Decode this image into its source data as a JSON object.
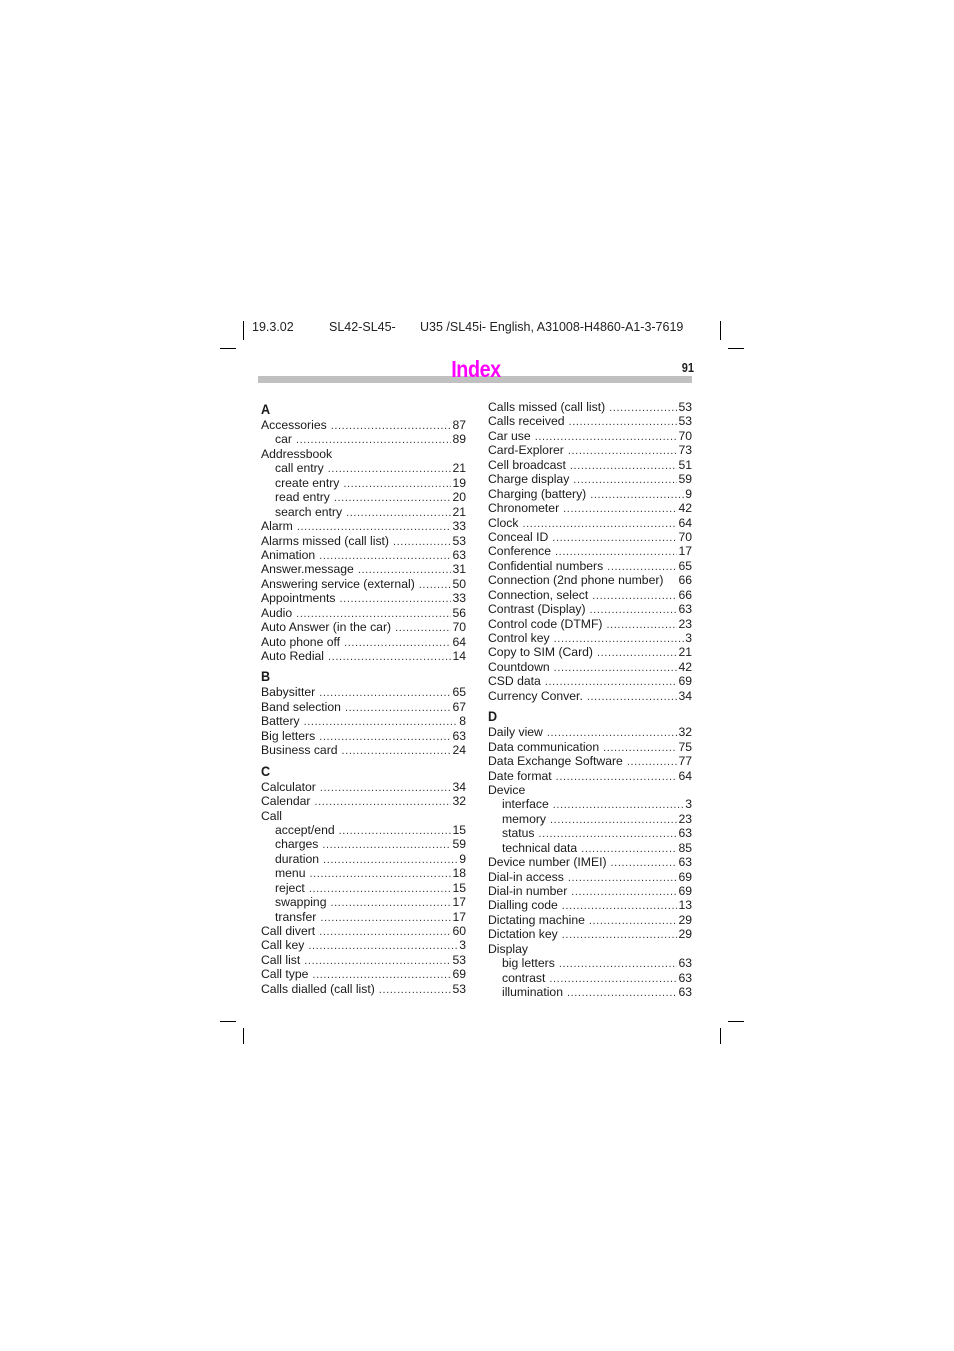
{
  "header": {
    "date": "19.3.02",
    "model": "SL42-SL45-",
    "doc_id": "U35 /SL45i- English, A31008-H4860-A1-3-7619"
  },
  "title": "Index",
  "page_number": "91",
  "colors": {
    "title": "#ff00ff",
    "rule": "#c0c0c0"
  },
  "columns": [
    {
      "sections": [
        {
          "letter": "A",
          "entries": [
            {
              "term": "Accessories",
              "page": "87"
            },
            {
              "term": "car",
              "page": "89",
              "sub": true
            },
            {
              "term": "Addressbook",
              "page": ""
            },
            {
              "term": "call entry",
              "page": "21",
              "sub": true
            },
            {
              "term": "create entry",
              "page": "19",
              "sub": true
            },
            {
              "term": "read entry",
              "page": "20",
              "sub": true
            },
            {
              "term": "search entry",
              "page": "21",
              "sub": true
            },
            {
              "term": "Alarm",
              "page": "33"
            },
            {
              "term": "Alarms missed (call list)",
              "page": "53"
            },
            {
              "term": "Animation",
              "page": "63"
            },
            {
              "term": "Answer.message",
              "page": "31"
            },
            {
              "term": "Answering service (external)",
              "page": "50"
            },
            {
              "term": "Appointments",
              "page": "33"
            },
            {
              "term": "Audio",
              "page": "56"
            },
            {
              "term": "Auto Answer (in the car)",
              "page": "70"
            },
            {
              "term": "Auto phone off",
              "page": "64"
            },
            {
              "term": "Auto Redial",
              "page": "14"
            }
          ]
        },
        {
          "letter": "B",
          "entries": [
            {
              "term": "Babysitter",
              "page": "65"
            },
            {
              "term": "Band selection",
              "page": "67"
            },
            {
              "term": "Battery",
              "page": "8"
            },
            {
              "term": "Big letters",
              "page": "63"
            },
            {
              "term": "Business card",
              "page": "24"
            }
          ]
        },
        {
          "letter": "C",
          "entries": [
            {
              "term": "Calculator",
              "page": "34"
            },
            {
              "term": "Calendar",
              "page": "32"
            },
            {
              "term": "Call",
              "page": ""
            },
            {
              "term": "accept/end",
              "page": "15",
              "sub": true
            },
            {
              "term": "charges",
              "page": "59",
              "sub": true
            },
            {
              "term": "duration",
              "page": "9",
              "sub": true
            },
            {
              "term": "menu",
              "page": "18",
              "sub": true
            },
            {
              "term": "reject",
              "page": "15",
              "sub": true
            },
            {
              "term": "swapping",
              "page": "17",
              "sub": true
            },
            {
              "term": "transfer",
              "page": "17",
              "sub": true
            },
            {
              "term": "Call divert",
              "page": "60"
            },
            {
              "term": "Call key",
              "page": "3"
            },
            {
              "term": "Call list",
              "page": "53"
            },
            {
              "term": "Call type",
              "page": "69"
            },
            {
              "term": "Calls dialled (call list)",
              "page": "53"
            }
          ]
        }
      ]
    },
    {
      "sections": [
        {
          "letter": "",
          "entries": [
            {
              "term": "Calls missed (call list)",
              "page": "53"
            },
            {
              "term": "Calls received",
              "page": "53"
            },
            {
              "term": "Car use",
              "page": "70"
            },
            {
              "term": "Card-Explorer",
              "page": "73"
            },
            {
              "term": "Cell broadcast",
              "page": "51"
            },
            {
              "term": "Charge display",
              "page": "59"
            },
            {
              "term": "Charging (battery)",
              "page": "9"
            },
            {
              "term": "Chronometer",
              "page": "42"
            },
            {
              "term": "Clock",
              "page": "64"
            },
            {
              "term": "Conceal ID",
              "page": "70"
            },
            {
              "term": "Conference",
              "page": "17"
            },
            {
              "term": "Confidential numbers",
              "page": "65"
            },
            {
              "term": "Connection (2nd phone number)",
              "page": "66",
              "nodots": true
            },
            {
              "term": "Connection, select",
              "page": "66"
            },
            {
              "term": "Contrast (Display)",
              "page": "63"
            },
            {
              "term": "Control code (DTMF)",
              "page": "23"
            },
            {
              "term": "Control key",
              "page": "3"
            },
            {
              "term": "Copy to SIM (Card)",
              "page": "21"
            },
            {
              "term": "Countdown",
              "page": "42"
            },
            {
              "term": "CSD data",
              "page": "69"
            },
            {
              "term": "Currency Conver.",
              "page": "34"
            }
          ]
        },
        {
          "letter": "D",
          "entries": [
            {
              "term": "Daily view",
              "page": "32"
            },
            {
              "term": "Data communication",
              "page": "75"
            },
            {
              "term": "Data Exchange Software",
              "page": "77"
            },
            {
              "term": "Date format",
              "page": "64"
            },
            {
              "term": "Device",
              "page": ""
            },
            {
              "term": "interface",
              "page": "3",
              "sub": true
            },
            {
              "term": "memory",
              "page": "23",
              "sub": true
            },
            {
              "term": "status",
              "page": "63",
              "sub": true
            },
            {
              "term": "technical data",
              "page": "85",
              "sub": true
            },
            {
              "term": "Device number (IMEI)",
              "page": "63"
            },
            {
              "term": "Dial-in access",
              "page": "69"
            },
            {
              "term": "Dial-in number",
              "page": "69"
            },
            {
              "term": "Dialling code",
              "page": "13"
            },
            {
              "term": "Dictating machine",
              "page": "29"
            },
            {
              "term": "Dictation key",
              "page": "29"
            },
            {
              "term": "Display",
              "page": ""
            },
            {
              "term": "big letters",
              "page": "63",
              "sub": true
            },
            {
              "term": "contrast",
              "page": "63",
              "sub": true
            },
            {
              "term": "illumination",
              "page": "63",
              "sub": true
            }
          ]
        }
      ]
    }
  ]
}
